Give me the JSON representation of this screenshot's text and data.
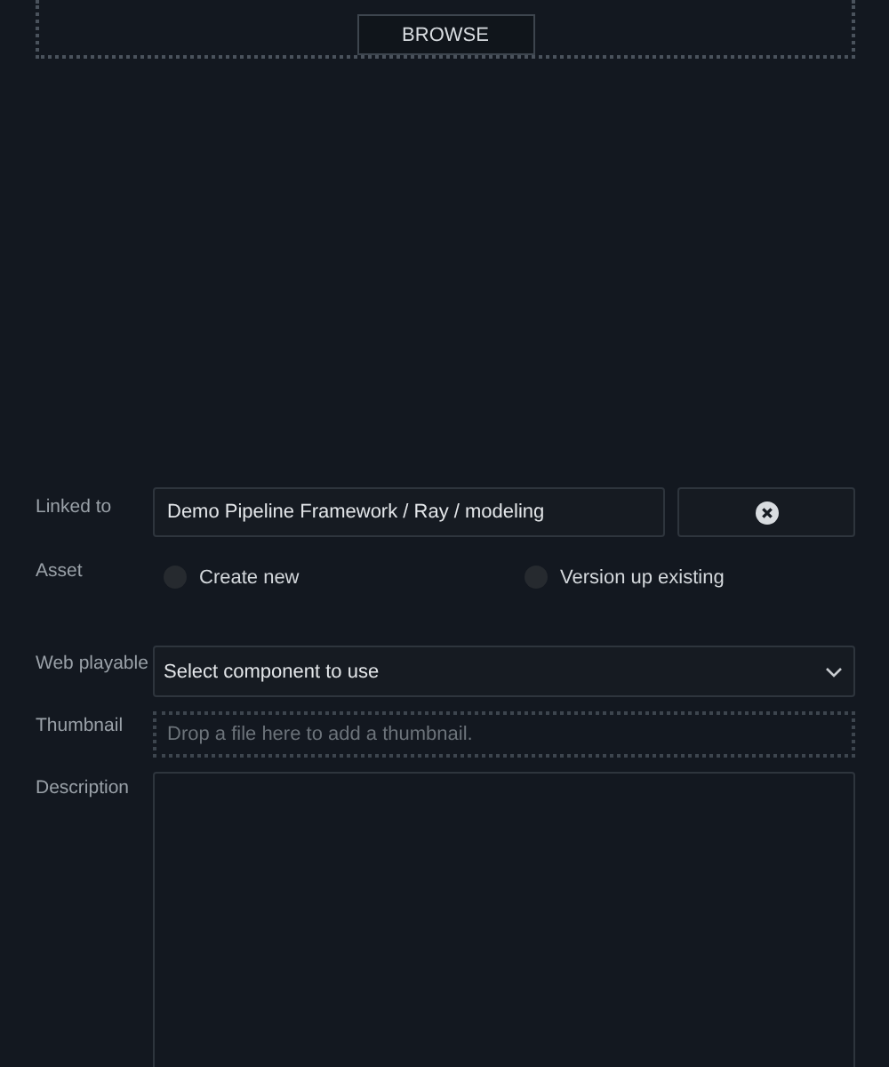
{
  "upload": {
    "button": "BROWSE"
  },
  "linked_to": {
    "label": "Linked to",
    "value": "Demo Pipeline Framework / Ray / modeling"
  },
  "asset": {
    "label": "Asset",
    "options": [
      {
        "label": "Create new",
        "selected": false
      },
      {
        "label": "Version up existing",
        "selected": false
      }
    ]
  },
  "web_playable": {
    "label": "Web playable",
    "value": "Select component to use"
  },
  "thumbnail": {
    "label": "Thumbnail",
    "placeholder": "Drop a file here to add a thumbnail."
  },
  "description": {
    "label": "Description"
  }
}
